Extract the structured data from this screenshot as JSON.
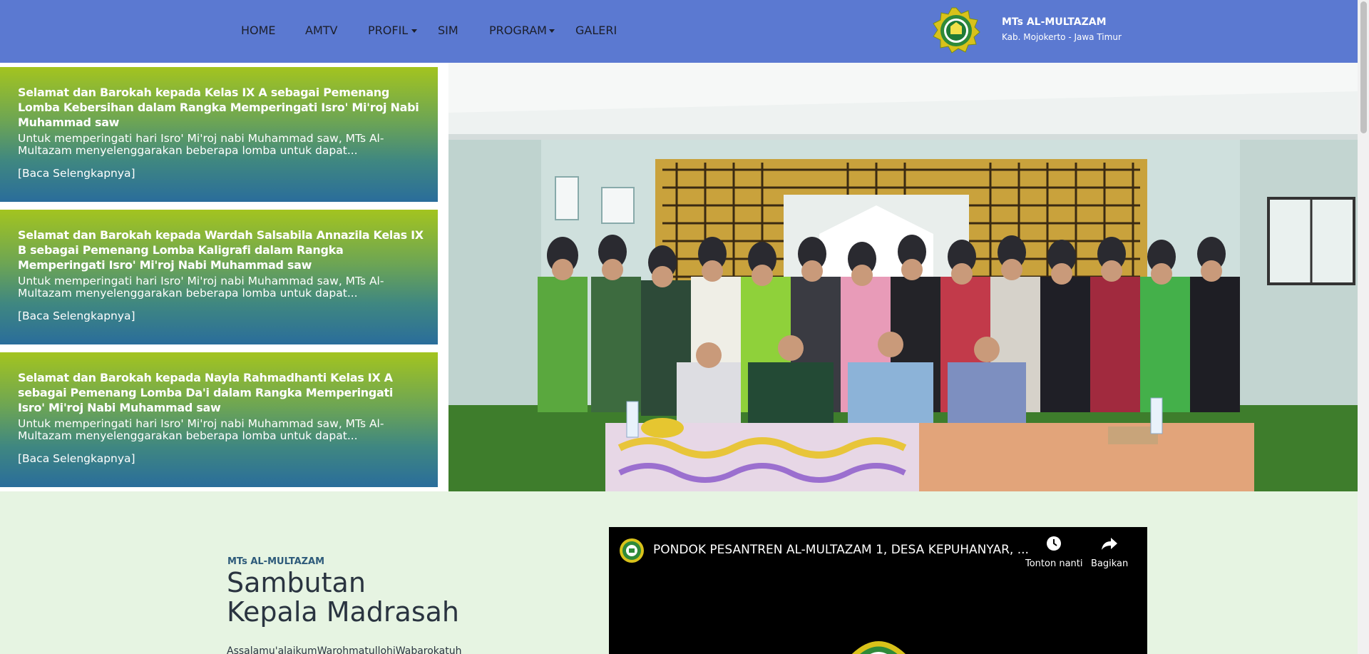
{
  "nav": {
    "items": [
      {
        "label": "HOME",
        "dropdown": false
      },
      {
        "label": "AMTV",
        "dropdown": false
      },
      {
        "label": "PROFIL",
        "dropdown": true
      },
      {
        "label": "SIM",
        "dropdown": false
      },
      {
        "label": "PROGRAM",
        "dropdown": true
      },
      {
        "label": "GALERI",
        "dropdown": false
      }
    ]
  },
  "brand": {
    "name": "MTs AL-MULTAZAM",
    "location": "Kab. Mojokerto - Jawa Timur"
  },
  "news": [
    {
      "title": "Selamat dan Barokah kepada Kelas IX A sebagai Pemenang Lomba Kebersihan dalam Rangka Memperingati Isro' Mi'roj Nabi Muhammad saw",
      "excerpt": "Untuk memperingati hari Isro' Mi'roj nabi Muhammad saw, MTs Al-Multazam menyelenggarakan beberapa lomba untuk dapat...",
      "link": "[Baca Selengkapnya]"
    },
    {
      "title": "Selamat dan Barokah kepada Wardah Salsabila Annazila Kelas IX B sebagai Pemenang Lomba Kaligrafi dalam Rangka Memperingati Isro' Mi'roj Nabi Muhammad saw",
      "excerpt": "Untuk memperingati hari Isro' Mi'roj nabi Muhammad saw, MTs Al-Multazam menyelenggarakan beberapa lomba untuk dapat...",
      "link": "[Baca Selengkapnya]"
    },
    {
      "title": "Selamat dan Barokah kepada Nayla Rahmadhanti Kelas IX A sebagai Pemenang Lomba Da'i dalam Rangka Memperingati Isro' Mi'roj Nabi Muhammad saw",
      "excerpt": "Untuk memperingati hari Isro' Mi'roj nabi Muhammad saw, MTs Al-Multazam menyelenggarakan beberapa lomba untuk dapat...",
      "link": "[Baca Selengkapnya]"
    }
  ],
  "welcome": {
    "kicker": "MTs AL-MULTAZAM",
    "heading_line1": "Sambutan",
    "heading_line2": "Kepala Madrasah",
    "greeting": "Assalamu'alaikumWarohmatullohiWabarokatuh"
  },
  "video": {
    "title": "PONDOK PESANTREN AL-MULTAZAM 1, DESA KEPUHANYAR, ...",
    "watch_later_label": "Tonton nanti",
    "share_label": "Bagikan",
    "watch_later_icon": "clock-icon",
    "share_icon": "share-arrow-icon"
  },
  "colors": {
    "header": "#5b79d1",
    "lower_bg": "#e6f4e2",
    "card_gradient_top": "#a3c41f",
    "card_gradient_bottom": "#2a6d9b"
  }
}
